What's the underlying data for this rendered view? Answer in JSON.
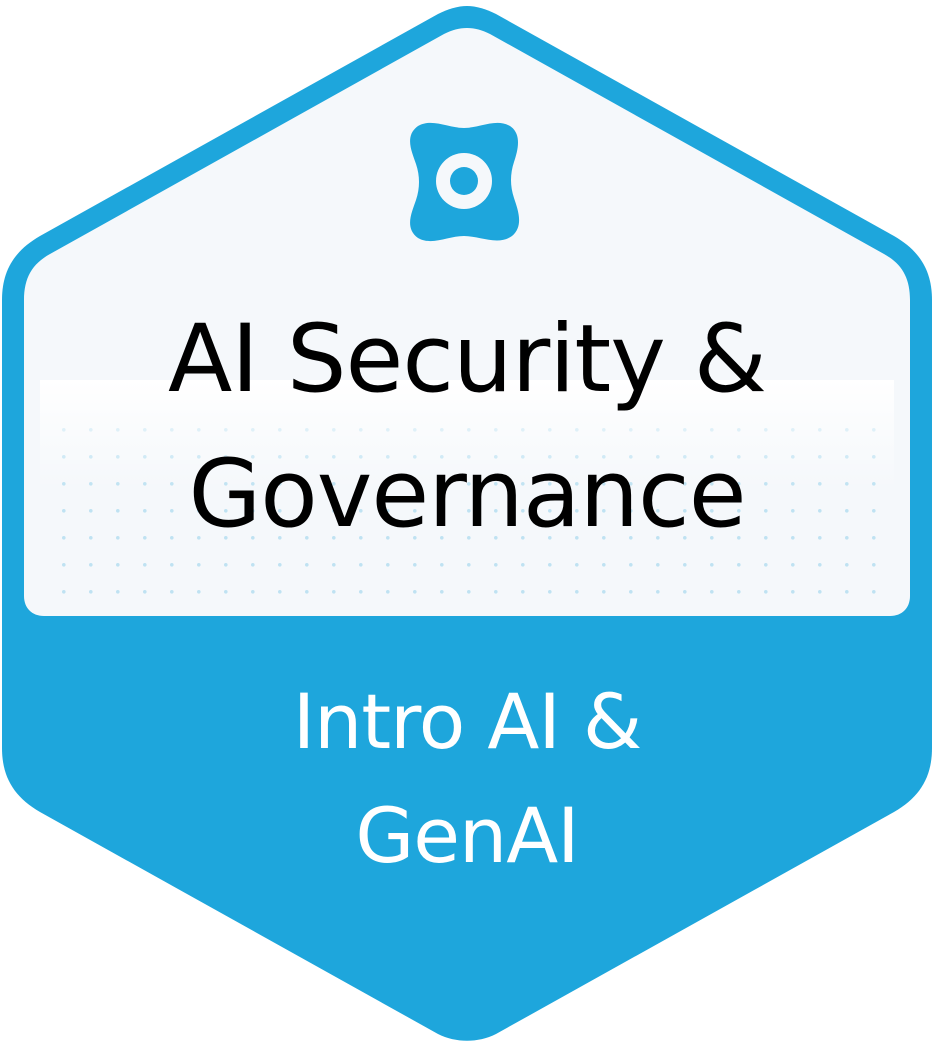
{
  "badge": {
    "title_lines": [
      "AI Security &",
      "Governance"
    ],
    "subtitle_lines": [
      "Intro AI &",
      "GenAI"
    ],
    "icon": "target-emblem-icon"
  },
  "colors": {
    "brand_blue": "#1ea6dc",
    "panel_white": "#f4f8fb",
    "dot_blue": "#bfe2f2",
    "title_text": "#000000",
    "subtitle_text": "#ffffff"
  }
}
